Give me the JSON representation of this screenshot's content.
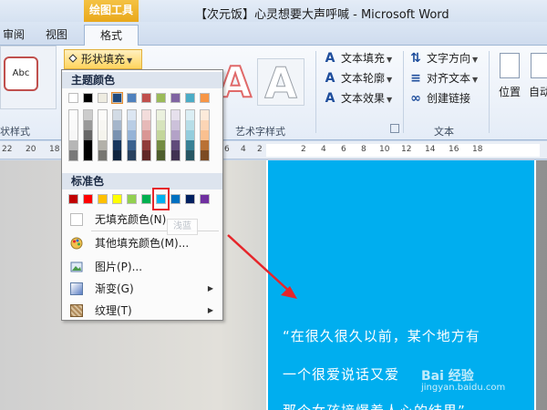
{
  "window": {
    "title": "【次元饭】心灵想要大声呼喊 - Microsoft Word",
    "context_tab": "绘图工具"
  },
  "tabs": {
    "review": "审阅",
    "view": "视图",
    "format": "格式"
  },
  "ribbon": {
    "shape_style_sample": "Abc",
    "shape_fill": "形状填充",
    "text_fill": "文本填充",
    "text_outline": "文本轮廓",
    "text_effect": "文本效果",
    "text_direction": "文字方向",
    "align_text": "对齐文本",
    "create_link": "创建链接",
    "position": "位置",
    "wrap": "自动",
    "group_shape_styles": "状样式",
    "group_art_styles": "艺术字样式",
    "group_text": "文本"
  },
  "ruler": {
    "ticks": [
      "22",
      "20",
      "18",
      "6",
      "4",
      "2",
      "2",
      "4",
      "6",
      "8",
      "10",
      "12",
      "14",
      "16",
      "18"
    ]
  },
  "fill_menu": {
    "theme_colors_heading": "主题颜色",
    "standard_colors_heading": "标准色",
    "no_fill": "无填充颜色(N)",
    "more_colors": "其他填充颜色(M)...",
    "picture": "图片(P)...",
    "gradient": "渐变(G)",
    "texture": "纹理(T)",
    "tooltip": "浅蓝",
    "theme_top_colors": [
      "#ffffff",
      "#000000",
      "#eeece1",
      "#1f497d",
      "#4f81bd",
      "#c0504d",
      "#9bbb59",
      "#8064a2",
      "#4bacc6",
      "#f79646"
    ],
    "standard_colors": [
      "#c00000",
      "#ff0000",
      "#ffc000",
      "#ffff00",
      "#92d050",
      "#00b050",
      "#00b0f0",
      "#0070c0",
      "#002060",
      "#7030a0"
    ],
    "selected_standard_index": 6
  },
  "document": {
    "line1": "“在很久很久以前，某个地方有",
    "line2": "一个很爱说话又爱",
    "line3": "那个女孩接爆着人心的结果”",
    "watermark": "Bai 经验",
    "watermark_url": "jingyan.baidu.com",
    "shape_color": "#00aeef"
  }
}
